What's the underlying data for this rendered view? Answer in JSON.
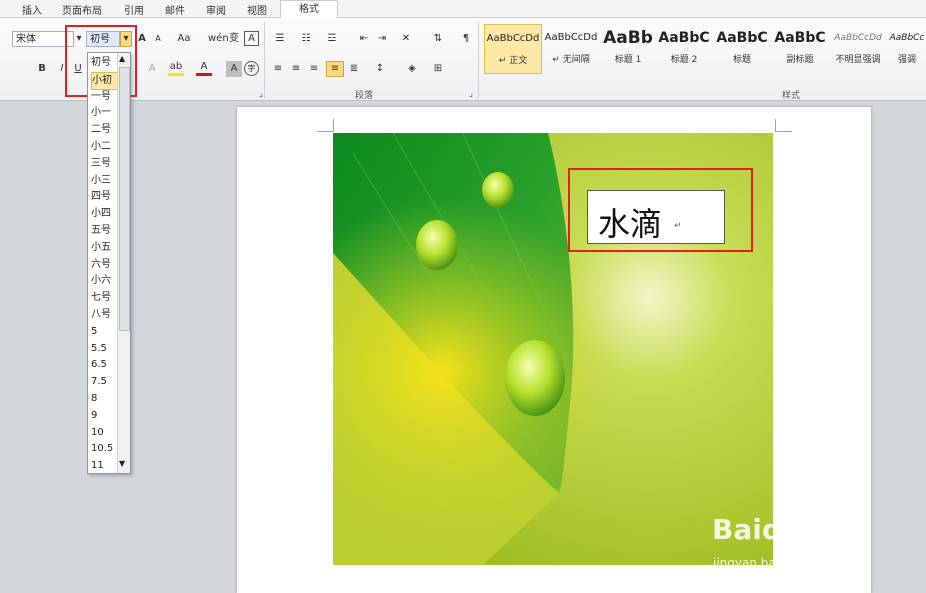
{
  "tabs": [
    {
      "label": "插入"
    },
    {
      "label": "页面布局"
    },
    {
      "label": "引用"
    },
    {
      "label": "邮件"
    },
    {
      "label": "审阅"
    },
    {
      "label": "视图"
    },
    {
      "label": "格式"
    }
  ],
  "font": {
    "family_value": "宋体",
    "size_value": "初号"
  },
  "toolbar": {
    "grow_font": "A",
    "shrink_font": "A",
    "change_case": "Aa",
    "bold": "B",
    "italic": "I",
    "underline": "U",
    "highlight": "ab",
    "font_color": "A",
    "char_shading": "A",
    "enclose": "字",
    "phonetic": "wén",
    "char_border": "A",
    "clear_format": "变"
  },
  "groups": {
    "paragraph": "段落",
    "styles": "样式"
  },
  "styles": [
    {
      "sample": "AaBbCcDd",
      "name": "↵ 正文"
    },
    {
      "sample": "AaBbCcDd",
      "name": "↵ 无间隔"
    },
    {
      "sample": "AaBb",
      "name": "标题 1"
    },
    {
      "sample": "AaBbC",
      "name": "标题 2"
    },
    {
      "sample": "AaBbC",
      "name": "标题"
    },
    {
      "sample": "AaBbC",
      "name": "副标题"
    },
    {
      "sample": "AaBbCcDd",
      "name": "不明显强调"
    },
    {
      "sample": "AaBbCc",
      "name": "强调"
    }
  ],
  "size_options": [
    "初号",
    "小初",
    "一号",
    "小一",
    "二号",
    "小二",
    "三号",
    "小三",
    "四号",
    "小四",
    "五号",
    "小五",
    "六号",
    "小六",
    "七号",
    "八号",
    "5",
    "5.5",
    "6.5",
    "7.5",
    "8",
    "9",
    "10",
    "10.5",
    "11"
  ],
  "document": {
    "textbox_text": "水滴"
  },
  "watermark": {
    "brand": "Baidu 经验",
    "url": "jingyan.baidu.com"
  }
}
